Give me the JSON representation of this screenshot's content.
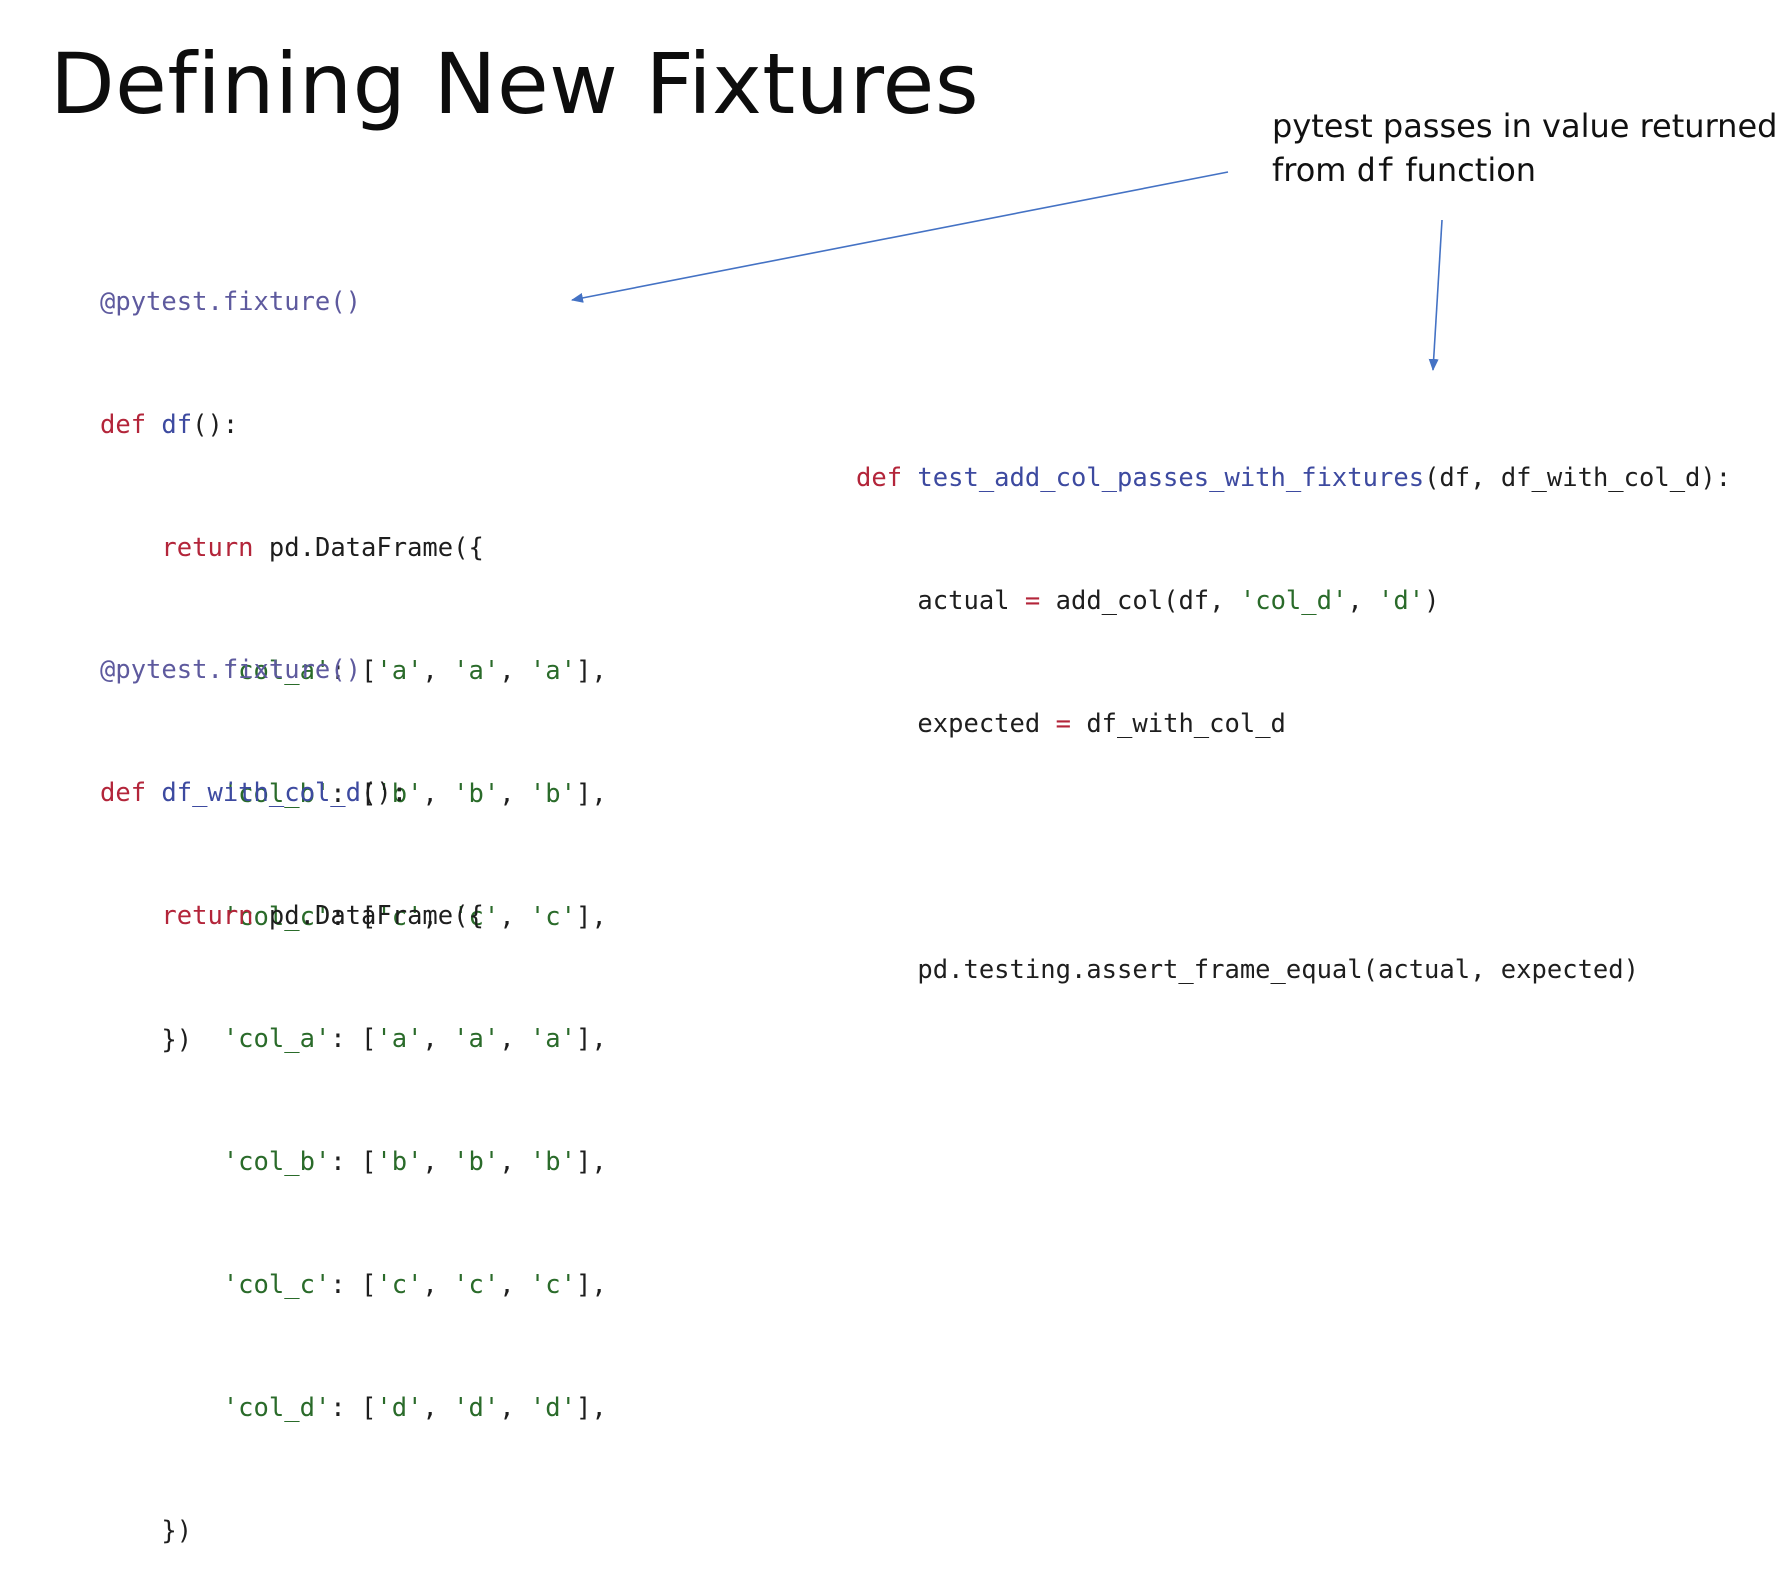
{
  "slide": {
    "title": "Defining New Fixtures"
  },
  "annotation": {
    "line1": "pytest passes in value returned",
    "line2_before": "from ",
    "line2_code": "df",
    "line2_after": " function"
  },
  "fixture_df": {
    "decorator": "@pytest.fixture()",
    "def_kw": "def",
    "name": "df",
    "sig_end": "():",
    "return_kw": "return",
    "call": "pd.DataFrame({",
    "rows": [
      {
        "key": "'col_a'",
        "sep": ": [",
        "v1": "'a'",
        "v2": "'a'",
        "v3": "'a'"
      },
      {
        "key": "'col_b'",
        "sep": ": [",
        "v1": "'b'",
        "v2": "'b'",
        "v3": "'b'"
      },
      {
        "key": "'col_c'",
        "sep": ": [",
        "v1": "'c'",
        "v2": "'c'",
        "v3": "'c'"
      }
    ],
    "close": "})"
  },
  "fixture_df_with_col_d": {
    "decorator": "@pytest.fixture()",
    "def_kw": "def",
    "name": "df_with_col_d",
    "sig_end": "():",
    "return_kw": "return",
    "call": "pd.DataFrame({",
    "rows": [
      {
        "key": "'col_a'",
        "sep": ": [",
        "v1": "'a'",
        "v2": "'a'",
        "v3": "'a'"
      },
      {
        "key": "'col_b'",
        "sep": ": [",
        "v1": "'b'",
        "v2": "'b'",
        "v3": "'b'"
      },
      {
        "key": "'col_c'",
        "sep": ": [",
        "v1": "'c'",
        "v2": "'c'",
        "v3": "'c'"
      },
      {
        "key": "'col_d'",
        "sep": ": [",
        "v1": "'d'",
        "v2": "'d'",
        "v3": "'d'"
      }
    ],
    "close": "})"
  },
  "test_function": {
    "def_kw": "def",
    "name": "test_add_col_passes_with_fixtures",
    "params": "(df, df_with_col_d):",
    "actual_var": "actual",
    "eq": "=",
    "actual_call": "add_col(df, ",
    "actual_arg1": "'col_d'",
    "actual_comma": ", ",
    "actual_arg2": "'d'",
    "actual_close": ")",
    "expected_var": "expected",
    "expected_val": "df_with_col_d",
    "assert_line": "pd.testing.assert_frame_equal(actual, expected)"
  },
  "colors": {
    "keyword": "#b3253a",
    "decorator": "#5e5a9e",
    "function_name": "#3d4aa0",
    "string": "#2a6b2a",
    "arrow": "#4472c4"
  }
}
